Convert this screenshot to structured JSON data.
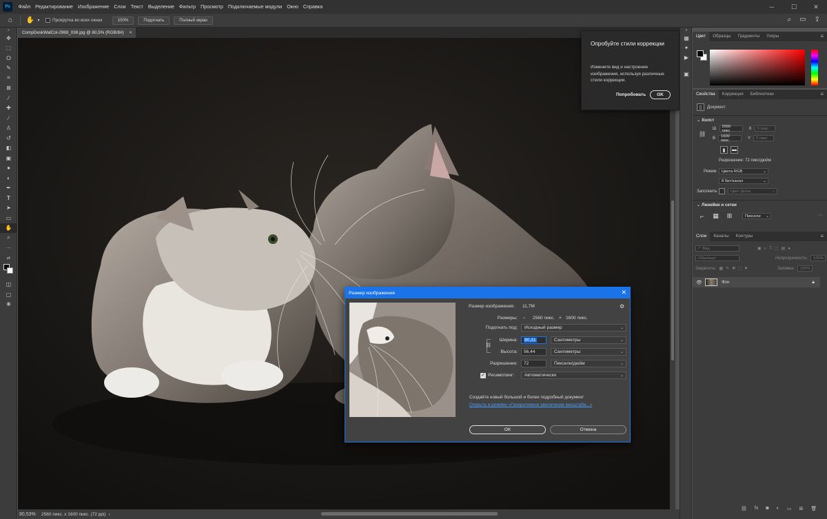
{
  "app": {
    "logo": "Ps",
    "menu": [
      "Файл",
      "Редактирование",
      "Изображение",
      "Слои",
      "Текст",
      "Выделение",
      "Фильтр",
      "Просмотр",
      "Подключаемые модули",
      "Окно",
      "Справка"
    ],
    "window_controls": [
      "minimize-icon",
      "maximize-icon",
      "close-icon"
    ]
  },
  "options_bar": {
    "scroll_all_label": "Прокрутка во всех окнах",
    "zoom_100": "100%",
    "fit_label": "Подогнать",
    "fullscreen_label": "Полный экран"
  },
  "document": {
    "tab_title": "CompDeskWalCol-2969_036.jpg @ 80,5% (RGB/8#)",
    "close": "×"
  },
  "status": {
    "zoom": "80,53%",
    "info": "2560 пикс. x 1600 пикс. (72 ppi)"
  },
  "tip": {
    "title": "Опробуйте стили коррекции",
    "body": "Измените вид и настроение изображения, используя различные стили коррекции.",
    "try_label": "Попробовать",
    "ok_label": "OK"
  },
  "color_panel": {
    "tabs": [
      "Цвет",
      "Образцы",
      "Градиенты",
      "Узоры"
    ],
    "foreground": "#000000",
    "background": "#ffffff",
    "hue": "#ff0000"
  },
  "properties": {
    "tabs": [
      "Свойства",
      "Коррекция",
      "Библиотеки"
    ],
    "doc_label": "Документ",
    "canvas_section": "Холст",
    "w_label": "Ш",
    "w_value": "2560 пикс",
    "h_label": "В",
    "h_value": "1600 пикс",
    "x_label": "X",
    "x_value": "0 пикс",
    "y_label": "Y",
    "y_value": "0 пикс",
    "resolution": "Разрешение: 72 пикс/дюйм",
    "mode_label": "Режим",
    "mode_value": "Цвета RGB",
    "depth_value": "8 бит/канал",
    "fill_label": "Заполнить",
    "fill_value": "Цвет фона",
    "rulers_section": "Линейки и сетки",
    "units_value": "Пиксели"
  },
  "layers": {
    "tabs": [
      "Слои",
      "Каналы",
      "Контуры"
    ],
    "search_placeholder": "Вид",
    "blend_mode": "Обычные",
    "opacity_label": "Непрозрачность:",
    "opacity_value": "100%",
    "lock_label": "Закрепить:",
    "fill_label": "Заливка:",
    "fill_value": "100%",
    "layer_name": "Фон"
  },
  "dialog": {
    "title": "Размер изображения",
    "image_size_label": "Размер изображения:",
    "image_size_value": "11,7M",
    "dimensions_label": "Размеры:",
    "dimensions_w": "2560 пикс.",
    "dimensions_x": "×",
    "dimensions_h": "1600 пикс.",
    "fit_label": "Подогнать под:",
    "fit_value": "Исходный размер",
    "width_label": "Ширина:",
    "width_value": "90,31",
    "width_unit": "Сантиметры",
    "height_label": "Высота:",
    "height_value": "56,44",
    "height_unit": "Сантиметры",
    "resolution_label": "Разрешение:",
    "resolution_value": "72",
    "resolution_unit": "Пиксели/дюйм",
    "resample_label": "Ресамплинг:",
    "resample_value": "Автоматически",
    "note": "Создайте новый большой и более подробный документ",
    "link": "Открыть в режиме «Генеративное увеличение масштаба...»",
    "ok_label": "OK",
    "cancel_label": "Отмена"
  }
}
